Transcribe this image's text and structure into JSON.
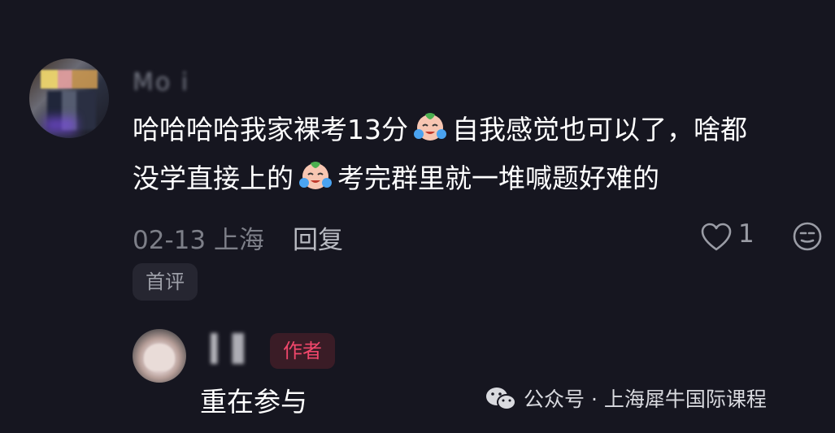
{
  "comment": {
    "username": "Mo i",
    "text_line1_a": "哈哈哈哈我家裸考13分",
    "text_line1_b": "自我感觉也可以了，啥都",
    "text_line2_a": "没学直接上的",
    "text_line2_b": "考完群里就一堆喊题好难的",
    "date_location": "02-13 上海",
    "reply_label": "回复",
    "like_count": "1",
    "first_comment_tag": "首评"
  },
  "reply": {
    "author_badge": "作者",
    "text": "重在参与"
  },
  "watermark": {
    "text": "公众号 · 上海犀牛国际课程"
  },
  "icons": {
    "emoji": "crying-laughing-emoji",
    "like": "heart-icon",
    "emoji_button": "face-emoji-icon",
    "wechat": "wechat-icon"
  },
  "colors": {
    "background": "#161620",
    "author_badge": "#f0476b",
    "muted_text": "#7d7f88"
  }
}
